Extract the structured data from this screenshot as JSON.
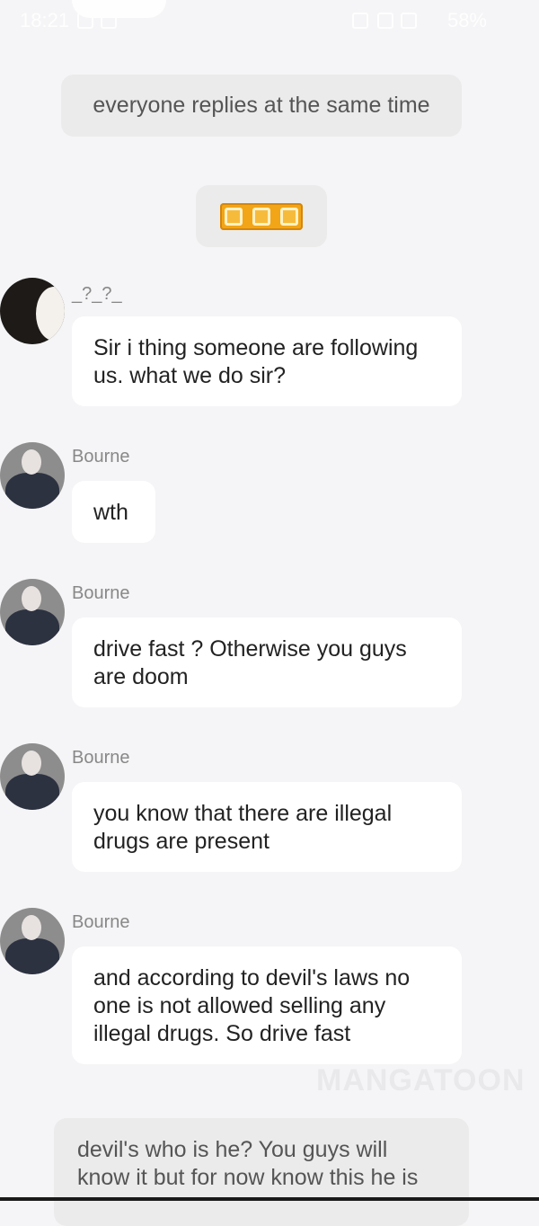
{
  "status_bar": {
    "time": "18:21",
    "battery": "58%"
  },
  "narration_1": "everyone replies at the same time",
  "sticker_icon": "three-phone-vibrate-sticker",
  "messages": [
    {
      "sender": "_?_?_",
      "text": "Sir i thing someone are following us. what we do sir?"
    },
    {
      "sender": "Bourne",
      "text": "wth"
    },
    {
      "sender": "Bourne",
      "text": "drive fast ? Otherwise you guys are doom"
    },
    {
      "sender": "Bourne",
      "text": "you know that there are illegal drugs are present"
    },
    {
      "sender": "Bourne",
      "text": "and according to devil's laws no one is not allowed selling any illegal drugs. So drive fast"
    }
  ],
  "watermark": "MANGATOON",
  "narration_2": "devil's who is he? You guys will know it but for now know this he is"
}
